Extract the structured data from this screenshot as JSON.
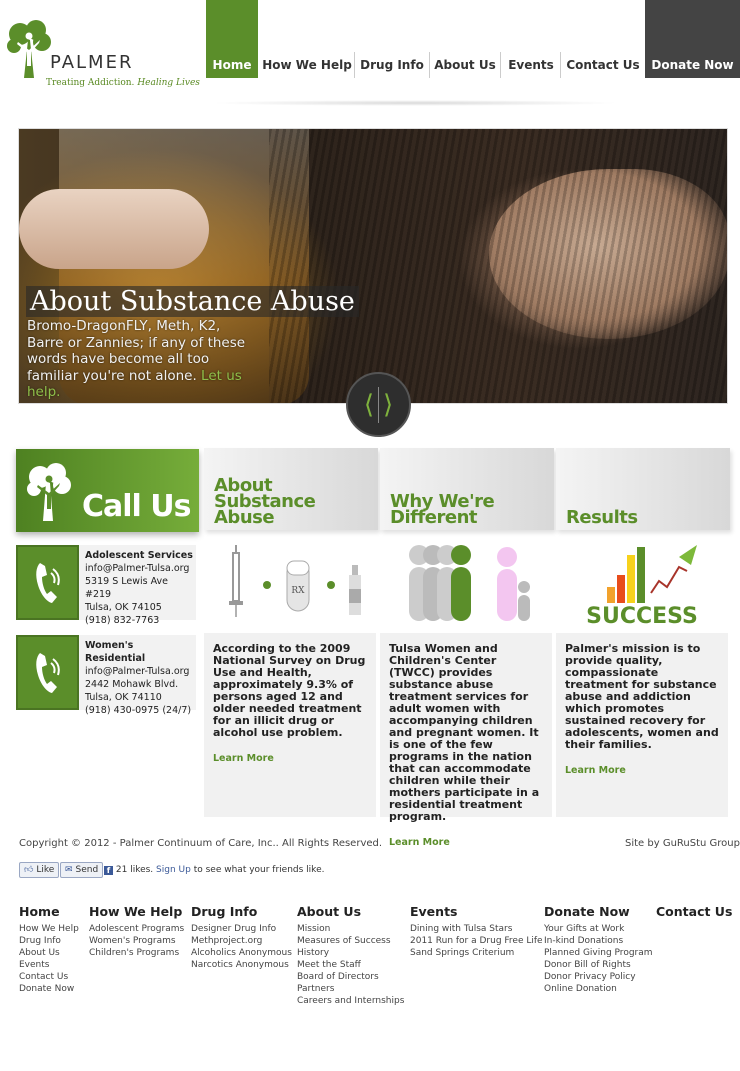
{
  "logo": {
    "name": "PALMER",
    "tagline_a": "Treating Addiction.",
    "tagline_b": "Healing Lives"
  },
  "nav": [
    {
      "label": "Home"
    },
    {
      "label": "How We Help"
    },
    {
      "label": "Drug Info"
    },
    {
      "label": "About Us"
    },
    {
      "label": "Events"
    },
    {
      "label": "Contact Us"
    },
    {
      "label": "Donate Now"
    }
  ],
  "hero": {
    "title": "About Substance Abuse",
    "text": "Bromo-DragonFLY, Meth, K2, Barre or Zannies; if any of these words have become all too familiar you're not alone.",
    "link": "Let us help."
  },
  "callus": {
    "label": "Call Us"
  },
  "locations": [
    {
      "name": "Adolescent Services",
      "email": "info@Palmer-Tulsa.org",
      "address": "5319 S Lewis Ave #219",
      "city": "Tulsa, OK 74105",
      "phone": "(918) 832-7763"
    },
    {
      "name": "Women's Residential",
      "email": "info@Palmer-Tulsa.org",
      "address": "2442 Mohawk Blvd.",
      "city": "Tulsa, OK 74110",
      "phone": "(918) 430-0975 (24/7)"
    }
  ],
  "cards": [
    {
      "title_1": "About",
      "title_2": "Substance",
      "title_3": "Abuse",
      "icon": "drug-objects-icon",
      "text": "According to the 2009 National Survey on Drug Use and Health, approximately 9.3% of persons aged 12 and older needed treatment for an illicit drug or alcohol use problem.",
      "more": "Learn More",
      "icon_label": "RX"
    },
    {
      "title_1": "Why We're",
      "title_2": "Different",
      "icon": "people-figures-icon",
      "text": "Tulsa Women and Children's Center (TWCC) provides substance abuse treatment services for adult women with accompanying children and pregnant women. It is one of the few programs in the nation that can accommodate children while their mothers participate in a residential treatment program.",
      "more": "Learn More"
    },
    {
      "title_1": "Results",
      "icon": "success-chart-icon",
      "text": "Palmer's mission is to provide quality, compassionate treatment for substance abuse and addiction which promotes sustained recovery for adolescents, women and their families.",
      "more": "Learn More",
      "icon_label": "SUCCESS"
    }
  ],
  "footer": {
    "copyright": "Copyright © 2012 - Palmer Continuum of Care, Inc.. All Rights Reserved.",
    "site_by": "Site by GuRuStu Group",
    "fb_like": "Like",
    "fb_send": "Send",
    "fb_count": "21 likes.",
    "fb_signup": "Sign Up",
    "fb_rest": "to see what your friends like.",
    "columns": [
      {
        "heading": "Home",
        "links": [
          "How We Help",
          "Drug Info",
          "About Us",
          "Events",
          "Contact Us",
          "Donate Now"
        ]
      },
      {
        "heading": "How We Help",
        "links": [
          "Adolescent Programs",
          "Women's Programs",
          "Children's Programs"
        ]
      },
      {
        "heading": "Drug Info",
        "links": [
          "Designer Drug Info",
          "Methproject.org",
          "Alcoholics Anonymous",
          "Narcotics Anonymous"
        ]
      },
      {
        "heading": "About Us",
        "links": [
          "Mission",
          "Measures of Success",
          "History",
          "Meet the Staff",
          "Board of Directors",
          "Partners",
          "Careers and Internships"
        ]
      },
      {
        "heading": "Events",
        "links": [
          "Dining with Tulsa Stars",
          "2011 Run for a Drug Free Life",
          "Sand Springs Criterium"
        ]
      },
      {
        "heading": "Donate Now",
        "links": [
          "Your Gifts at Work",
          "In-kind Donations",
          "Planned Giving Program",
          "Donor Bill of Rights",
          "Donor Privacy Policy",
          "Online Donation"
        ]
      },
      {
        "heading": "Contact Us",
        "links": []
      }
    ]
  },
  "colors": {
    "brand_green": "#5b8e2a",
    "dark": "#444444"
  }
}
